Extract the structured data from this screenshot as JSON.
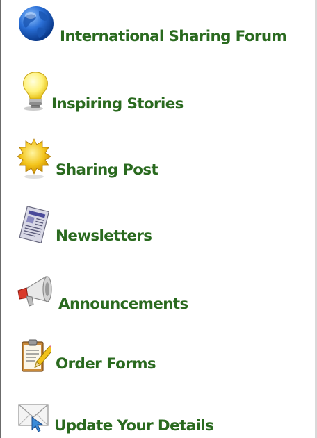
{
  "nav_menu": {
    "items": [
      {
        "id": "forum",
        "label": "International Sharing Forum",
        "icon": "globe-icon"
      },
      {
        "id": "stories",
        "label": "Inspiring Stories",
        "icon": "lightbulb-icon"
      },
      {
        "id": "post",
        "label": "Sharing Post",
        "icon": "sun-icon"
      },
      {
        "id": "newsletters",
        "label": "Newsletters",
        "icon": "newspaper-icon"
      },
      {
        "id": "announcements",
        "label": "Announcements",
        "icon": "megaphone-icon"
      },
      {
        "id": "orders",
        "label": "Order Forms",
        "icon": "clipboard-pencil-icon"
      },
      {
        "id": "update",
        "label": "Update Your Details",
        "icon": "envelope-icon"
      }
    ]
  },
  "colors": {
    "link_text": "#2a6a1f",
    "background": "#ffffff"
  }
}
